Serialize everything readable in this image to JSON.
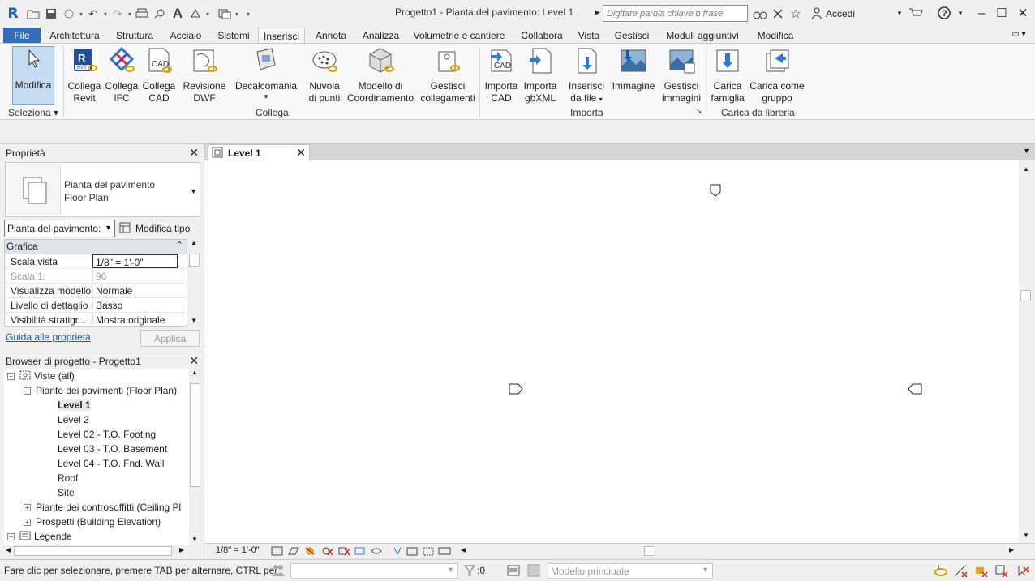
{
  "titlebar": {
    "doc_title": "Progetto1 - Pianta del pavimento: Level 1",
    "search_placeholder": "Digitare parola chiave o frase",
    "signin_label": "Accedi"
  },
  "tabs": [
    "File",
    "Architettura",
    "Struttura",
    "Acciaio",
    "Sistemi",
    "Inserisci",
    "Annota",
    "Analizza",
    "Volumetrie e cantiere",
    "Collabora",
    "Vista",
    "Gestisci",
    "Moduli aggiuntivi",
    "Modifica"
  ],
  "active_tab": "Inserisci",
  "ribbon": {
    "modify": "Modifica",
    "select_panel": "Seleziona",
    "link_panel": "Collega",
    "import_panel": "Importa",
    "library_panel": "Carica da libreria",
    "buttons": {
      "link_revit": [
        "Collega",
        "Revit"
      ],
      "link_ifc": [
        "Collega",
        "IFC"
      ],
      "link_cad": [
        "Collega",
        "CAD"
      ],
      "dwf_markup": [
        "Revisione",
        "DWF"
      ],
      "decal": [
        "Decalcomania",
        ""
      ],
      "point_cloud": [
        "Nuvola",
        "di punti"
      ],
      "coordination_model": [
        "Modello di",
        "Coordinamento"
      ],
      "manage_links": [
        "Gestisci",
        "collegamenti"
      ],
      "import_cad": [
        "Importa",
        "CAD"
      ],
      "import_gbxml": [
        "Importa",
        "gbXML"
      ],
      "insert_from_file": [
        "Inserisci",
        "da file"
      ],
      "image": [
        "Immagine",
        ""
      ],
      "manage_images": [
        "Gestisci",
        "immagini"
      ],
      "load_family": [
        "Carica",
        "famiglia"
      ],
      "load_group": [
        "Carica come",
        "gruppo"
      ]
    }
  },
  "properties": {
    "title": "Proprietà",
    "type_line1": "Pianta del pavimento",
    "type_line2": "Floor Plan",
    "instance_selector": "Pianta del pavimento:",
    "edit_type": "Modifica tipo",
    "group_header": "Grafica",
    "rows": [
      {
        "key": "Scala vista",
        "value": "1/8\" = 1'-0\""
      },
      {
        "key": "Scala 1:",
        "value": "96"
      },
      {
        "key": "Visualizza modello",
        "value": "Normale"
      },
      {
        "key": "Livello di dettaglio",
        "value": "Basso"
      },
      {
        "key": "Visibilità stratigr...",
        "value": "Mostra originale"
      }
    ],
    "help_link": "Guida alle proprietà",
    "apply": "Applica"
  },
  "browser": {
    "title": "Browser di progetto - Progetto1",
    "nodes": [
      "Viste (all)",
      "Piante dei pavimenti (Floor Plan)",
      "Level 1",
      "Level 2",
      "Level 02 - T.O. Footing",
      "Level 03 - T.O. Basement",
      "Level 04 - T.O. Fnd. Wall",
      "Roof",
      "Site",
      "Piante dei controsoffitti (Ceiling Pl",
      "Prospetti (Building Elevation)",
      "Legende"
    ]
  },
  "view": {
    "tab_label": "Level 1",
    "scale": "1/8\" = 1'-0\""
  },
  "status": {
    "message": "Fare clic per selezionare, premere TAB per alternare, CTRL per",
    "count": ":0",
    "model": "Modello principale"
  },
  "colors": {
    "file_tab": "#2f6eba",
    "accent": "#1a5aa6",
    "selected_button": "#c6dcf2"
  }
}
